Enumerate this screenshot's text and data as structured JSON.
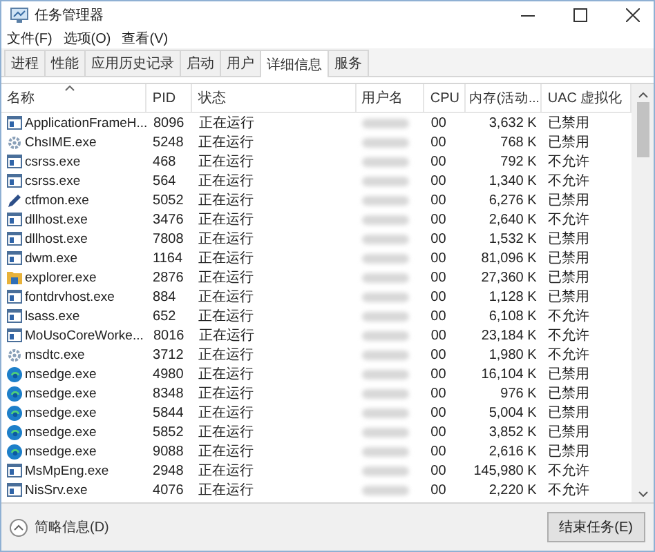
{
  "window": {
    "title": "任务管理器"
  },
  "menu": [
    "文件(F)",
    "选项(O)",
    "查看(V)"
  ],
  "tabs": [
    {
      "label": "进程",
      "selected": false
    },
    {
      "label": "性能",
      "selected": false
    },
    {
      "label": "应用历史记录",
      "selected": false
    },
    {
      "label": "启动",
      "selected": false
    },
    {
      "label": "用户",
      "selected": false
    },
    {
      "label": "详细信息",
      "selected": true
    },
    {
      "label": "服务",
      "selected": false
    }
  ],
  "table": {
    "columns": [
      "名称",
      "PID",
      "状态",
      "用户名",
      "CPU",
      "内存(活动...",
      "UAC 虚拟化"
    ],
    "rows": [
      {
        "kind": "window",
        "name": "ApplicationFrameH...",
        "pid": "8096",
        "status": "正在运行",
        "cpu": "00",
        "memory": "3,632 K",
        "uac": "已禁用"
      },
      {
        "kind": "ime",
        "name": "ChsIME.exe",
        "pid": "5248",
        "status": "正在运行",
        "cpu": "00",
        "memory": "768 K",
        "uac": "已禁用"
      },
      {
        "kind": "window",
        "name": "csrss.exe",
        "pid": "468",
        "status": "正在运行",
        "cpu": "00",
        "memory": "792 K",
        "uac": "不允许"
      },
      {
        "kind": "window",
        "name": "csrss.exe",
        "pid": "564",
        "status": "正在运行",
        "cpu": "00",
        "memory": "1,340 K",
        "uac": "不允许"
      },
      {
        "kind": "pen",
        "name": "ctfmon.exe",
        "pid": "5052",
        "status": "正在运行",
        "cpu": "00",
        "memory": "6,276 K",
        "uac": "已禁用"
      },
      {
        "kind": "window",
        "name": "dllhost.exe",
        "pid": "3476",
        "status": "正在运行",
        "cpu": "00",
        "memory": "2,640 K",
        "uac": "不允许"
      },
      {
        "kind": "window",
        "name": "dllhost.exe",
        "pid": "7808",
        "status": "正在运行",
        "cpu": "00",
        "memory": "1,532 K",
        "uac": "已禁用"
      },
      {
        "kind": "window",
        "name": "dwm.exe",
        "pid": "1164",
        "status": "正在运行",
        "cpu": "00",
        "memory": "81,096 K",
        "uac": "已禁用"
      },
      {
        "kind": "folder",
        "name": "explorer.exe",
        "pid": "2876",
        "status": "正在运行",
        "cpu": "00",
        "memory": "27,360 K",
        "uac": "已禁用"
      },
      {
        "kind": "window",
        "name": "fontdrvhost.exe",
        "pid": "884",
        "status": "正在运行",
        "cpu": "00",
        "memory": "1,128 K",
        "uac": "已禁用"
      },
      {
        "kind": "window",
        "name": "lsass.exe",
        "pid": "652",
        "status": "正在运行",
        "cpu": "00",
        "memory": "6,108 K",
        "uac": "不允许"
      },
      {
        "kind": "window",
        "name": "MoUsoCoreWorke...",
        "pid": "8016",
        "status": "正在运行",
        "cpu": "00",
        "memory": "23,184 K",
        "uac": "不允许"
      },
      {
        "kind": "ime",
        "name": "msdtc.exe",
        "pid": "3712",
        "status": "正在运行",
        "cpu": "00",
        "memory": "1,980 K",
        "uac": "不允许"
      },
      {
        "kind": "edge",
        "name": "msedge.exe",
        "pid": "4980",
        "status": "正在运行",
        "cpu": "00",
        "memory": "16,104 K",
        "uac": "已禁用"
      },
      {
        "kind": "edge",
        "name": "msedge.exe",
        "pid": "8348",
        "status": "正在运行",
        "cpu": "00",
        "memory": "976 K",
        "uac": "已禁用"
      },
      {
        "kind": "edge",
        "name": "msedge.exe",
        "pid": "5844",
        "status": "正在运行",
        "cpu": "00",
        "memory": "5,004 K",
        "uac": "已禁用"
      },
      {
        "kind": "edge",
        "name": "msedge.exe",
        "pid": "5852",
        "status": "正在运行",
        "cpu": "00",
        "memory": "3,852 K",
        "uac": "已禁用"
      },
      {
        "kind": "edge",
        "name": "msedge.exe",
        "pid": "9088",
        "status": "正在运行",
        "cpu": "00",
        "memory": "2,616 K",
        "uac": "已禁用"
      },
      {
        "kind": "window",
        "name": "MsMpEng.exe",
        "pid": "2948",
        "status": "正在运行",
        "cpu": "00",
        "memory": "145,980 K",
        "uac": "不允许"
      },
      {
        "kind": "window",
        "name": "NisSrv.exe",
        "pid": "4076",
        "status": "正在运行",
        "cpu": "00",
        "memory": "2,220 K",
        "uac": "不允许"
      }
    ]
  },
  "footer": {
    "details_toggle": "简略信息(D)",
    "end_task": "结束任务(E)"
  }
}
